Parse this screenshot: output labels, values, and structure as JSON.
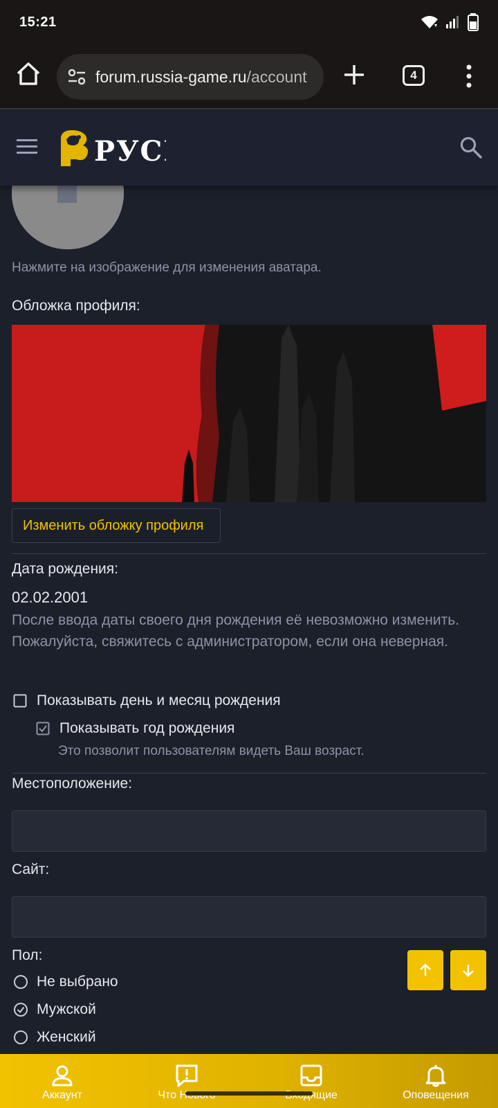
{
  "status_bar": {
    "time": "15:21"
  },
  "browser": {
    "url_domain": "forum.russia-game.ru",
    "url_path": "/account",
    "tab_count": "4"
  },
  "site": {
    "logo_text": "РУСЬ"
  },
  "profile": {
    "avatar_hint": "Нажмите на изображение для изменения аватара.",
    "cover_label": "Обложка профиля:",
    "cover_button": "Изменить обложку профиля",
    "birthdate_label": "Дата рождения:",
    "birthdate_value": "02.02.2001",
    "birthdate_hint": "После ввода даты своего дня рождения её невозможно изменить. Пожалуйста, свяжитесь с администратором, если она неверная.",
    "show_day_month": "Показывать день и месяц рождения",
    "show_day_month_checked": false,
    "show_year": "Показывать год рождения",
    "show_year_checked": true,
    "show_year_hint": "Это позволит пользователям видеть Ваш возраст.",
    "location_label": "Местоположение:",
    "location_value": "",
    "website_label": "Сайт:",
    "website_value": "",
    "gender_label": "Пол:",
    "gender_options": [
      "Не выбрано",
      "Мужской",
      "Женский"
    ],
    "gender_selected": "Мужской"
  },
  "bottom_nav": {
    "items": [
      {
        "label": "Аккаунт",
        "icon": "person-icon"
      },
      {
        "label": "Что Нового",
        "icon": "alert-message-icon"
      },
      {
        "label": "Входящие",
        "icon": "inbox-icon"
      },
      {
        "label": "Оповещения",
        "icon": "bell-icon"
      }
    ]
  },
  "colors": {
    "accent": "#f2c200",
    "background": "#1c202b",
    "header": "#1e2230",
    "muted_text": "#8b93a6"
  }
}
